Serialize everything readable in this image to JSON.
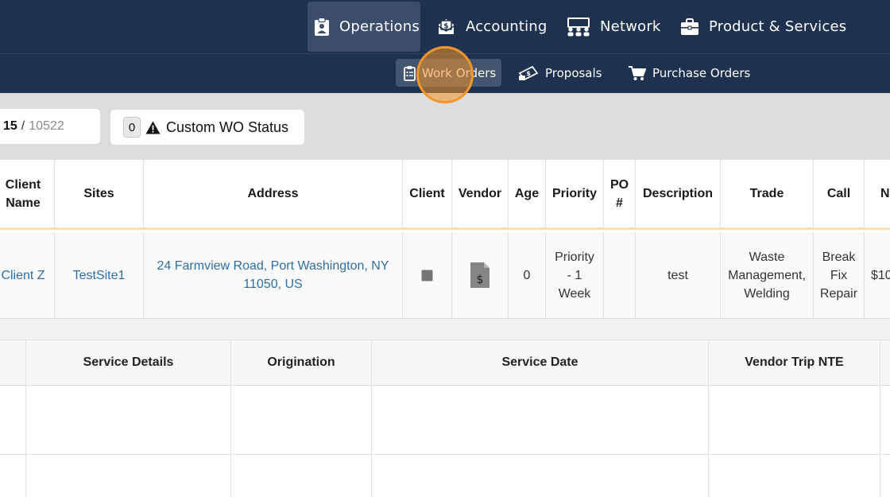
{
  "topnav": {
    "items": [
      {
        "label": "Operations",
        "icon": "clipboard-user-icon",
        "active": true
      },
      {
        "label": "Accounting",
        "icon": "money-envelope-icon",
        "active": false
      },
      {
        "label": "Network",
        "icon": "users-network-icon",
        "active": false
      },
      {
        "label": "Product & Services",
        "icon": "briefcase-icon",
        "active": false
      }
    ]
  },
  "subnav": {
    "items": [
      {
        "label": "Work Orders",
        "icon": "clipboard-list-icon",
        "active": true
      },
      {
        "label": "Proposals",
        "icon": "money-bill-hand-icon",
        "active": false
      },
      {
        "label": "Purchase Orders",
        "icon": "shopping-cart-icon",
        "active": false
      }
    ]
  },
  "filters": {
    "current_count": "15",
    "separator": "/",
    "total_count": "10522",
    "status_badge": "0",
    "status_label": "Custom WO Status"
  },
  "table1": {
    "headers": [
      "Client\nName",
      "Sites",
      "Address",
      "Client",
      "Vendor",
      "Age",
      "Priority",
      "PO\n#",
      "Description",
      "Trade",
      "Call",
      "N"
    ],
    "row": {
      "client_name": "Client Z",
      "site": "TestSite1",
      "address": "24 Farmview Road, Port Washington, NY 11050, US",
      "age": "0",
      "priority": "Priority - 1 Week",
      "po": "",
      "description": "test",
      "trade": "Waste Management, Welding",
      "call": "Break Fix Repair",
      "nte": "$10"
    }
  },
  "table2": {
    "headers": [
      "",
      "Service Details",
      "Origination",
      "Service Date",
      "Vendor Trip NTE",
      ""
    ]
  },
  "colors": {
    "nav_bg": "#1e3250",
    "active_nav": "#3b4d6b",
    "link": "#2e6da4",
    "header_accent": "#f6e0b8",
    "cursor": "#f0962a"
  }
}
